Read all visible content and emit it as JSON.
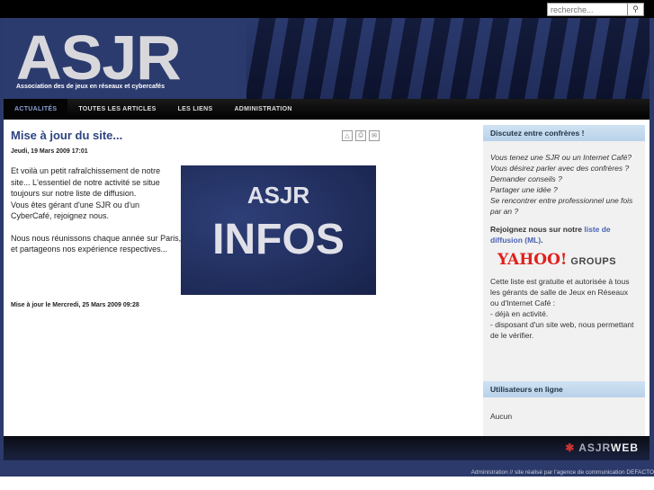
{
  "search": {
    "placeholder": "recherche...",
    "icon": "search-icon"
  },
  "header": {
    "logo": "ASJR",
    "tagline": "Association des de jeux en réseaux et cybercafés"
  },
  "nav": [
    {
      "label": "ACTUALITÉS",
      "active": true
    },
    {
      "label": "TOUTES LES ARTICLES"
    },
    {
      "label": "LES LIENS"
    },
    {
      "label": "ADMINISTRATION"
    }
  ],
  "article": {
    "title": "Mise à jour du site...",
    "date": "Jeudi, 19 Mars 2009 17:01",
    "paragraphs": [
      "Et voilà un petit rafraîchissement de notre site... L'essentiel de notre activité se situe toujours sur notre liste de diffusion.",
      "Vous êtes gérant d'une SJR ou d'un CyberCafé, rejoignez nous.",
      "Nous nous réunissons chaque année sur Paris, et partageons nos expérience respectives..."
    ],
    "image": {
      "top": "ASJR",
      "bottom": "INFOS"
    },
    "modified": "Mise à jour le Mercredi, 25 Mars 2009 09:28",
    "icons": [
      "pdf-icon",
      "print-icon",
      "email-icon"
    ]
  },
  "sidebar": {
    "discuss": {
      "title": "Discutez entre confrères !",
      "questions": [
        "Vous tenez une SJR ou un Internet Café?",
        "Vous désirez parler avec des confrères ?",
        "Demander conseils ?",
        "Partager une idée ?",
        "Se rencontrer entre professionnel une fois par an ?"
      ],
      "join_text": "Rejoignez nous sur notre ",
      "join_link": "liste de diffusion (ML)",
      "join_end": ".",
      "yahoo": "YAHOO!",
      "groups": "GROUPS",
      "desc": "Cette liste est gratuite et autorisée à tous les gérants de salle de Jeux en Réseaux ou d'Internet Café :",
      "conditions": [
        "- déjà en activité.",
        "- disposant d'un site web, nous permettant de le vérifier."
      ]
    },
    "online": {
      "title": "Utilisateurs en ligne",
      "value": "Aucun"
    }
  },
  "footer": {
    "logo_a": "ASJR",
    "logo_b": "WEB",
    "credit": "Administration // site réalisé par l'agence de communication DEFACTO"
  }
}
